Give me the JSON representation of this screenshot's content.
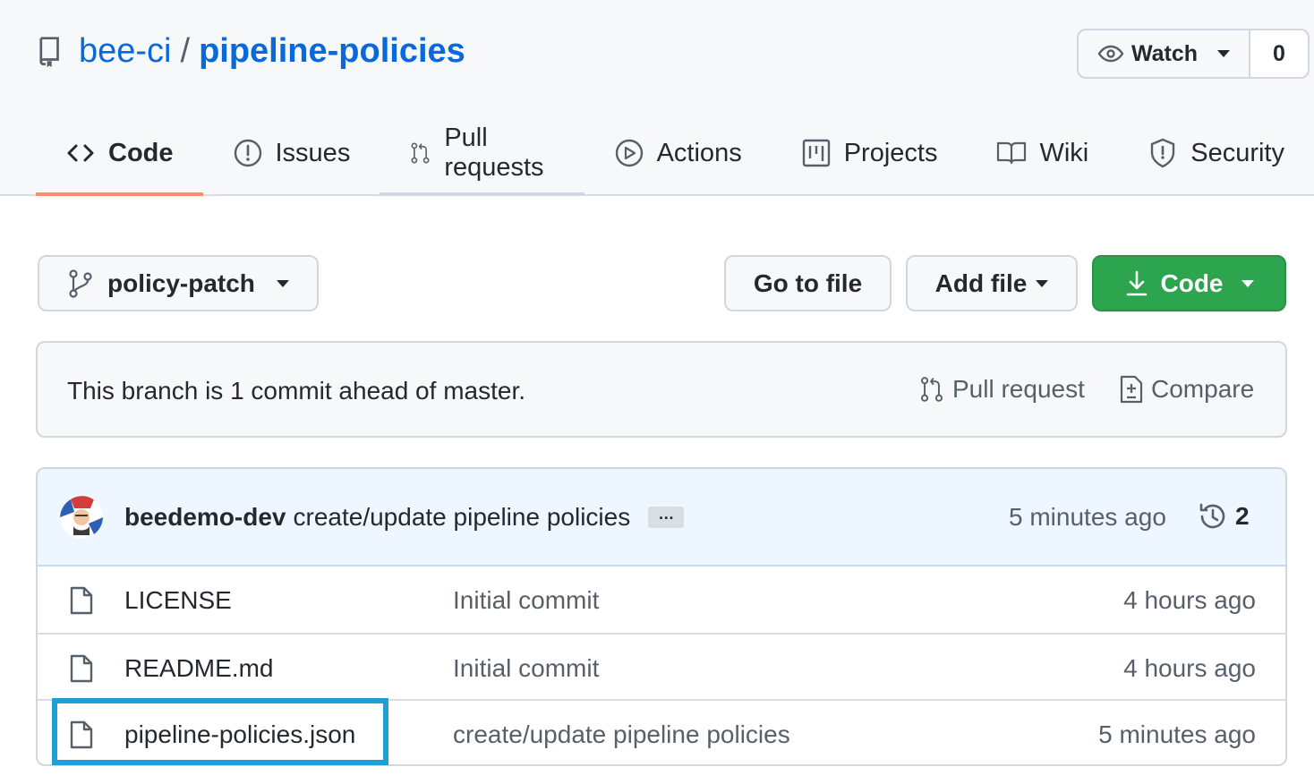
{
  "repo": {
    "owner": "bee-ci",
    "separator": "/",
    "name": "pipeline-policies"
  },
  "watch": {
    "label": "Watch",
    "count": "0"
  },
  "tabs": [
    {
      "label": "Code",
      "icon": "code-icon"
    },
    {
      "label": "Issues",
      "icon": "issue-icon"
    },
    {
      "label": "Pull requests",
      "icon": "pull-request-icon"
    },
    {
      "label": "Actions",
      "icon": "play-icon"
    },
    {
      "label": "Projects",
      "icon": "project-icon"
    },
    {
      "label": "Wiki",
      "icon": "book-icon"
    },
    {
      "label": "Security",
      "icon": "shield-icon"
    }
  ],
  "toolbar": {
    "branch": "policy-patch",
    "go_to_file": "Go to file",
    "add_file": "Add file",
    "code": "Code"
  },
  "branch_info": {
    "text": "This branch is 1 commit ahead of master.",
    "pull_request": "Pull request",
    "compare": "Compare"
  },
  "latest_commit": {
    "author": "beedemo-dev",
    "message": "create/update pipeline policies",
    "ellipsis": "…",
    "time": "5 minutes ago",
    "commit_count": "2"
  },
  "files": [
    {
      "name": "LICENSE",
      "commit": "Initial commit",
      "time": "4 hours ago"
    },
    {
      "name": "README.md",
      "commit": "Initial commit",
      "time": "4 hours ago"
    },
    {
      "name": "pipeline-policies.json",
      "commit": "create/update pipeline policies",
      "time": "5 minutes ago"
    }
  ],
  "colors": {
    "link": "#0969da",
    "accent_tab": "#fd8c73",
    "green": "#2da44e",
    "highlight": "#1f9fd8"
  }
}
